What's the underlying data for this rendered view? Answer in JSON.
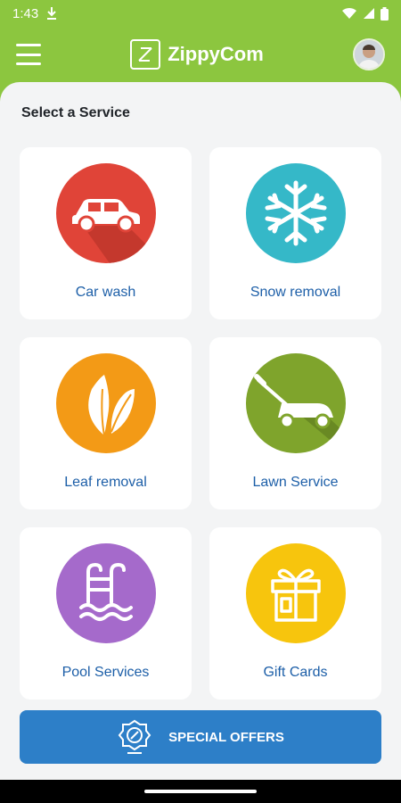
{
  "status_bar": {
    "time": "1:43",
    "icons": [
      "download-icon",
      "wifi-icon",
      "signal-icon",
      "battery-icon"
    ]
  },
  "app_bar": {
    "title": "ZippyCom",
    "icons": [
      "menu-icon",
      "logo-icon",
      "avatar"
    ]
  },
  "main": {
    "heading": "Select a Service",
    "services": [
      {
        "label": "Car wash",
        "icon": "car-icon",
        "color": "#e04438"
      },
      {
        "label": "Snow removal",
        "icon": "snowflake-icon",
        "color": "#35b8c8"
      },
      {
        "label": "Leaf removal",
        "icon": "leaf-icon",
        "color": "#f39a16"
      },
      {
        "label": "Lawn Service",
        "icon": "lawn-mower-icon",
        "color": "#7fa42c"
      },
      {
        "label": "Pool Services",
        "icon": "pool-ladder-icon",
        "color": "#a56acb"
      },
      {
        "label": "Gift Cards",
        "icon": "gift-icon",
        "color": "#f7c50d"
      }
    ]
  },
  "bottom": {
    "offers_label": "SPECIAL OFFERS",
    "offers_icon": "discount-badge-icon"
  },
  "colors": {
    "brand": "#8cc63f",
    "accent": "#2d7fc8",
    "label": "#1d5fa8"
  }
}
